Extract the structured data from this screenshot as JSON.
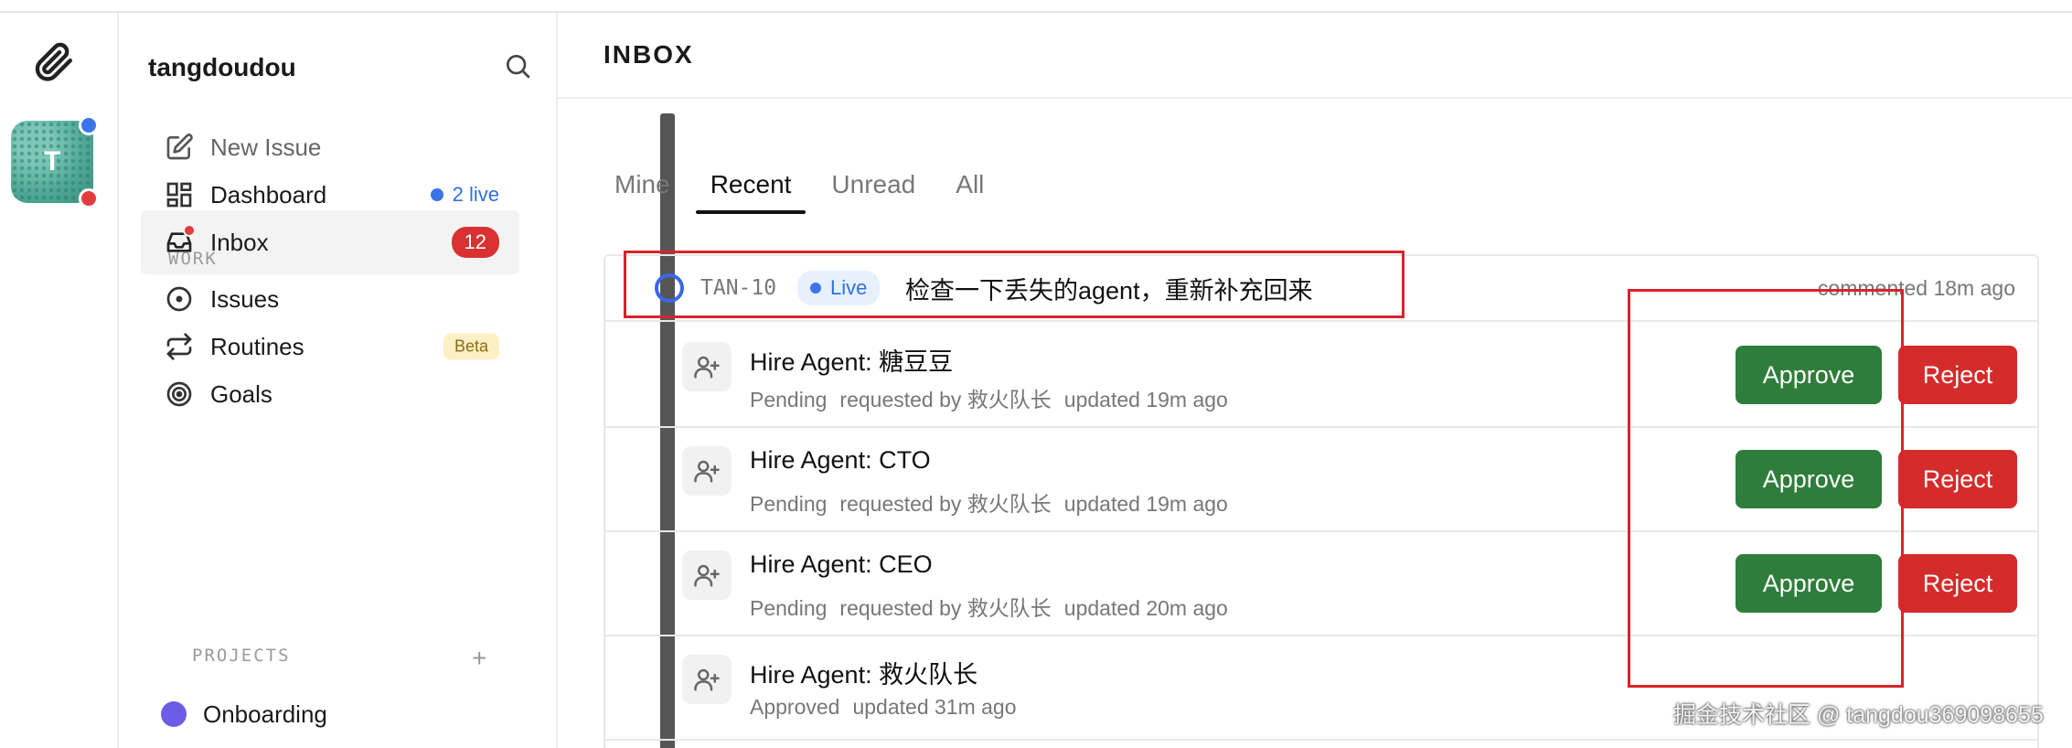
{
  "rail": {
    "icon": "paperclip-icon",
    "avatar_letter": "T"
  },
  "sidebar": {
    "workspace": "tangdoudou",
    "nav": [
      {
        "label": "New Issue",
        "icon": "edit-icon"
      },
      {
        "label": "Dashboard",
        "icon": "dashboard-icon",
        "badge": "2 live"
      },
      {
        "label": "Inbox",
        "icon": "inbox-icon",
        "badge": "12"
      }
    ],
    "work_label": "WORK",
    "work": [
      {
        "label": "Issues",
        "icon": "issues-icon"
      },
      {
        "label": "Routines",
        "icon": "routines-icon",
        "badge": "Beta"
      },
      {
        "label": "Goals",
        "icon": "goals-icon"
      }
    ],
    "projects_label": "PROJECTS",
    "projects_add": "+",
    "projects": [
      {
        "label": "Onboarding",
        "color": "#6c5ce7"
      }
    ]
  },
  "main": {
    "title": "INBOX",
    "tabs": [
      "Mine",
      "Recent",
      "Unread",
      "All"
    ],
    "active_tab": "Recent",
    "issue": {
      "id": "TAN-10",
      "live": "Live",
      "title": "检查一下丢失的agent，重新补充回来",
      "meta": "commented 18m ago"
    },
    "approvals": [
      {
        "title": "Hire Agent: 糖豆豆",
        "status": "Pending",
        "requested": "requested by 救火队长",
        "updated": "updated 19m ago",
        "approve": "Approve",
        "reject": "Reject"
      },
      {
        "title": "Hire Agent: CTO",
        "status": "Pending",
        "requested": "requested by 救火队长",
        "updated": "updated 19m ago",
        "approve": "Approve",
        "reject": "Reject"
      },
      {
        "title": "Hire Agent: CEO",
        "status": "Pending",
        "requested": "requested by 救火队长",
        "updated": "updated 20m ago",
        "approve": "Approve",
        "reject": "Reject"
      },
      {
        "title": "Hire Agent: 救火队长",
        "status": "Approved",
        "updated": "updated 31m ago"
      }
    ]
  },
  "watermark": "掘金技术社区 @ tangdou369098655",
  "colors": {
    "approve": "#2f7d3a",
    "reject": "#d42b2b",
    "accent_blue": "#3b74e8",
    "annotation": "#d9232d"
  }
}
